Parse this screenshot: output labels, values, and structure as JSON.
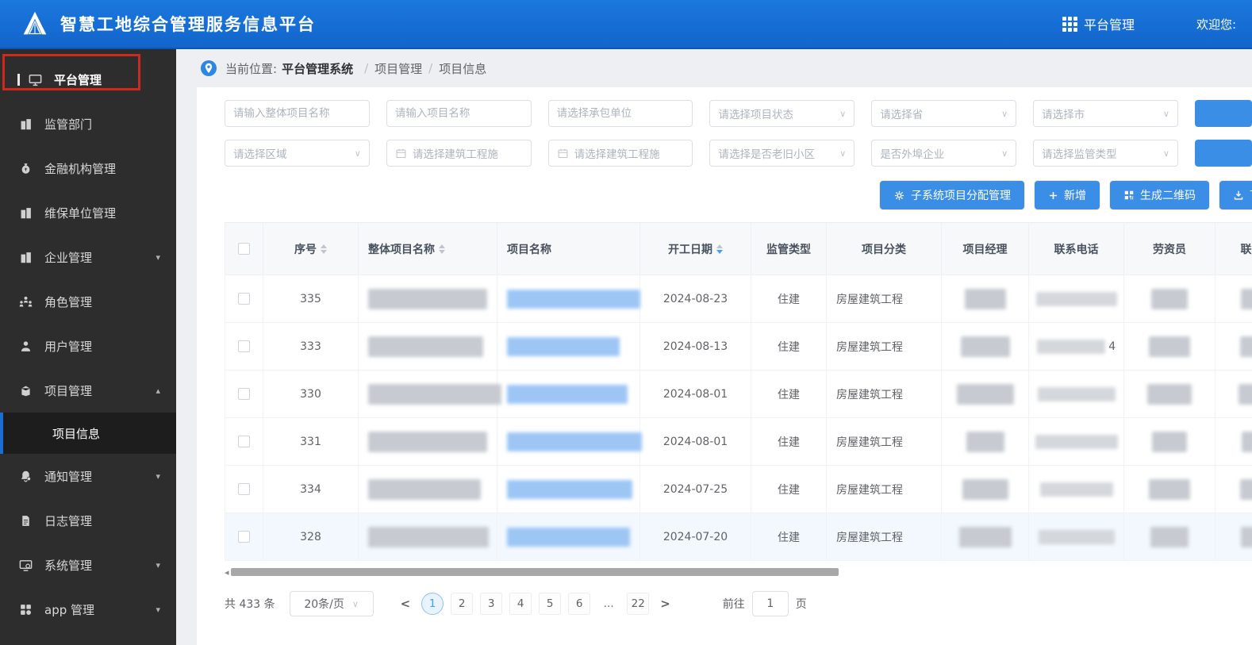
{
  "colors": {
    "header_blue": "#1265cc",
    "button_blue": "#3a8ee6",
    "active_page_blue": "#409eff",
    "annotation_red": "#d0281c",
    "sidebar_dark": "#2d2d2d"
  },
  "header": {
    "title": "智慧工地综合管理服务信息平台",
    "nav_label": "平台管理",
    "welcome": "欢迎您:"
  },
  "sidebar": {
    "items": [
      {
        "label": "平台管理",
        "icon": "monitor-icon",
        "top": true,
        "annotated": true
      },
      {
        "label": "监管部门",
        "icon": "building-icon"
      },
      {
        "label": "金融机构管理",
        "icon": "moneybag-icon"
      },
      {
        "label": "维保单位管理",
        "icon": "building-icon"
      },
      {
        "label": "企业管理",
        "icon": "building-icon",
        "arrow": "down"
      },
      {
        "label": "角色管理",
        "icon": "roles-icon"
      },
      {
        "label": "用户管理",
        "icon": "user-icon"
      },
      {
        "label": "项目管理",
        "icon": "project-icon",
        "arrow": "up"
      },
      {
        "label": "项目信息",
        "submenu": true,
        "selected": true
      },
      {
        "label": "通知管理",
        "icon": "bell-icon",
        "arrow": "down"
      },
      {
        "label": "日志管理",
        "icon": "log-icon"
      },
      {
        "label": "系统管理",
        "icon": "system-icon",
        "arrow": "down"
      },
      {
        "label": "app 管理",
        "icon": "app-icon",
        "arrow": "down"
      }
    ]
  },
  "breadcrumb": {
    "prefix": "当前位置:",
    "root": "平台管理系统",
    "separator": "/",
    "trail": [
      "项目管理",
      "项目信息"
    ]
  },
  "filters": {
    "row1": [
      {
        "placeholder": "请输入整体项目名称",
        "type": "text"
      },
      {
        "placeholder": "请输入项目名称",
        "type": "text"
      },
      {
        "placeholder": "请选择承包单位",
        "type": "text"
      },
      {
        "placeholder": "请选择项目状态",
        "type": "select"
      },
      {
        "placeholder": "请选择省",
        "type": "select"
      },
      {
        "placeholder": "请选择市",
        "type": "select"
      }
    ],
    "row2": [
      {
        "placeholder": "请选择区域",
        "type": "select"
      },
      {
        "placeholder": "请选择建筑工程施",
        "type": "date"
      },
      {
        "placeholder": "请选择建筑工程施",
        "type": "date"
      },
      {
        "placeholder": "请选择是否老旧小区",
        "type": "select"
      },
      {
        "placeholder": "是否外埠企业",
        "type": "select"
      },
      {
        "placeholder": "请选择监管类型",
        "type": "select"
      }
    ]
  },
  "actions": [
    {
      "label": "子系统项目分配管理",
      "icon": "gear-icon"
    },
    {
      "label": "新增",
      "icon": "plus-icon"
    },
    {
      "label": "生成二维码",
      "icon": "qrcode-icon"
    },
    {
      "label": "下载",
      "icon": "download-icon"
    }
  ],
  "table": {
    "columns": [
      {
        "label": "序号",
        "sortable": true
      },
      {
        "label": "整体项目名称",
        "sortable": true
      },
      {
        "label": "项目名称"
      },
      {
        "label": "开工日期",
        "sortable": true,
        "sort": "desc"
      },
      {
        "label": "监管类型"
      },
      {
        "label": "项目分类"
      },
      {
        "label": "项目经理"
      },
      {
        "label": "联系电话"
      },
      {
        "label": "劳资员"
      },
      {
        "label": "联系电话"
      }
    ],
    "redacted_columns": [
      "整体项目名称",
      "项目名称",
      "项目经理",
      "联系电话",
      "劳资员"
    ],
    "rows": [
      {
        "seq": "335",
        "start_date": "2024-08-23",
        "supervision": "住建",
        "category": "房屋建筑工程",
        "phone_visible": ""
      },
      {
        "seq": "333",
        "start_date": "2024-08-13",
        "supervision": "住建",
        "category": "房屋建筑工程",
        "phone_visible": "4"
      },
      {
        "seq": "330",
        "start_date": "2024-08-01",
        "supervision": "住建",
        "category": "房屋建筑工程",
        "phone_visible": ""
      },
      {
        "seq": "331",
        "start_date": "2024-08-01",
        "supervision": "住建",
        "category": "房屋建筑工程",
        "phone_visible": ""
      },
      {
        "seq": "334",
        "start_date": "2024-07-25",
        "supervision": "住建",
        "category": "房屋建筑工程",
        "phone_visible": ""
      },
      {
        "seq": "328",
        "start_date": "2024-07-20",
        "supervision": "住建",
        "category": "房屋建筑工程",
        "phone_visible": "",
        "highlighted": true
      }
    ]
  },
  "pagination": {
    "total": "共 433 条",
    "page_size": "20条/页",
    "prev": "<",
    "next": ">",
    "pages": [
      "1",
      "2",
      "3",
      "4",
      "5",
      "6",
      "...",
      "22"
    ],
    "active_page": "1",
    "goto_prefix": "前往",
    "goto_value": "1",
    "goto_suffix": "页"
  }
}
